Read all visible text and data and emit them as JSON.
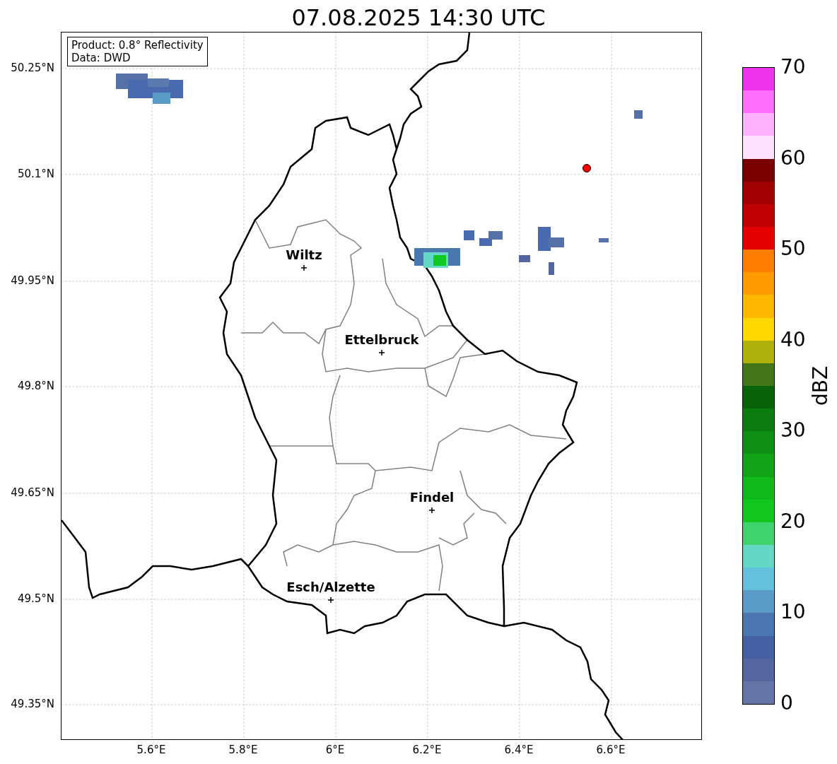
{
  "title": "07.08.2025 14:30 UTC",
  "info_box": [
    "Product: 0.8° Reflectivity",
    "Data: DWD"
  ],
  "lat_labels": [
    "50.25°N",
    "50.1°N",
    "49.95°N",
    "49.8°N",
    "49.65°N",
    "49.5°N",
    "49.35°N"
  ],
  "lon_labels": [
    "5.6°E",
    "5.8°E",
    "6°E",
    "6.2°E",
    "6.4°E",
    "6.6°E"
  ],
  "cities": [
    {
      "name": "Wiltz"
    },
    {
      "name": "Ettelbruck"
    },
    {
      "name": "Findel"
    },
    {
      "name": "Esch/Alzette"
    }
  ],
  "colorbar": {
    "label": "dBZ",
    "ticks": [
      "70",
      "60",
      "50",
      "40",
      "30",
      "20",
      "10",
      "0"
    ],
    "bins": [
      {
        "color": "#6675a8"
      },
      {
        "color": "#5466a0"
      },
      {
        "color": "#4560a3"
      },
      {
        "color": "#4a77b0"
      },
      {
        "color": "#5a9bc8"
      },
      {
        "color": "#63c1dc"
      },
      {
        "color": "#64d8c4"
      },
      {
        "color": "#3fd46d"
      },
      {
        "color": "#12c81e"
      },
      {
        "color": "#10b81a"
      },
      {
        "color": "#0fa315"
      },
      {
        "color": "#0f8f14"
      },
      {
        "color": "#0b7a0f"
      },
      {
        "color": "#08620a"
      },
      {
        "color": "#44771a"
      },
      {
        "color": "#b0b10a"
      },
      {
        "color": "#ffd800"
      },
      {
        "color": "#ffb800"
      },
      {
        "color": "#ff9a00"
      },
      {
        "color": "#ff7d00"
      },
      {
        "color": "#e40000"
      },
      {
        "color": "#c00000"
      },
      {
        "color": "#a00000"
      },
      {
        "color": "#7b0000"
      },
      {
        "color": "#ffe0ff"
      },
      {
        "color": "#ffb3ff"
      },
      {
        "color": "#ff6eff"
      },
      {
        "color": "#ee33ee"
      }
    ]
  }
}
